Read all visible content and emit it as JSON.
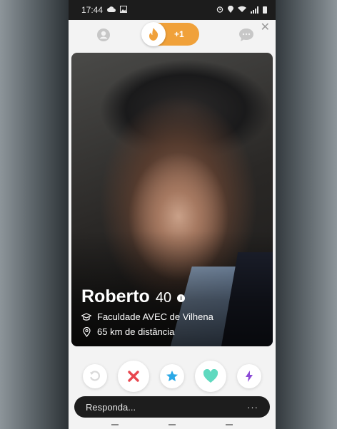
{
  "status_bar": {
    "time": "17:44",
    "left_icons": [
      "cloud-icon",
      "gallery-icon"
    ],
    "right_icons": [
      "alarm-icon",
      "location-icon",
      "wifi-icon",
      "signal-icon",
      "battery-icon"
    ]
  },
  "topnav": {
    "profile_icon": "person-icon",
    "toggle_icon": "flame-icon",
    "boost_label": "+1",
    "chat_icon": "chat-bubble-icon",
    "close_icon": "close-icon",
    "accent": "#f0a13a"
  },
  "card": {
    "name": "Roberto",
    "age": "40",
    "school": "Faculdade AVEC de Vilhena",
    "distance": "65 km de distância",
    "info_icon": "info-icon",
    "school_icon": "graduation-cap-icon",
    "distance_icon": "location-pin-icon"
  },
  "actions": [
    {
      "name": "rewind-button",
      "icon": "rewind-icon",
      "color": "#e0c27a"
    },
    {
      "name": "nope-button",
      "icon": "close-x-icon",
      "color": "#e8464e"
    },
    {
      "name": "super-like-button",
      "icon": "star-icon",
      "color": "#2aa8e6"
    },
    {
      "name": "like-button",
      "icon": "heart-icon",
      "color": "#47d6b6"
    },
    {
      "name": "boost-button",
      "icon": "lightning-icon",
      "color": "#8b49d6"
    }
  ],
  "reply": {
    "placeholder": "Responda...",
    "more": "···"
  }
}
